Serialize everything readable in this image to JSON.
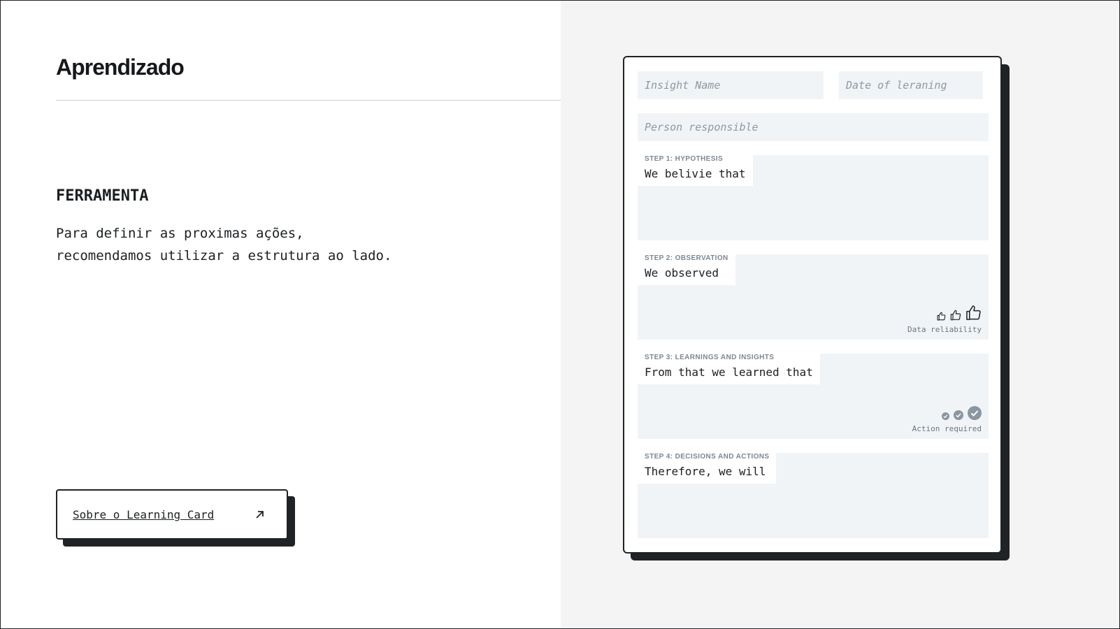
{
  "left": {
    "title": "Aprendizado",
    "section_label": "FERRAMENTA",
    "description_line1": "Para definir as proximas ações,",
    "description_line2": "recomendamos utilizar a estrutura ao lado.",
    "link_button_label": "Sobre o Learning Card",
    "link_button_icon": "arrow-up-right-icon"
  },
  "card": {
    "insight_name_placeholder": "Insight Name",
    "date_placeholder": "Date of leraning",
    "person_placeholder": "Person responsible",
    "steps": [
      {
        "label": "STEP 1: HYPOTHESIS",
        "text": "We belivie that"
      },
      {
        "label": "STEP 2: OBSERVATION",
        "text": "We observed",
        "rating_caption": "Data reliability",
        "rating_icon": "thumbs-up-icon"
      },
      {
        "label": "STEP 3: LEARNINGS AND INSIGHTS",
        "text": "From that we learned that",
        "rating_caption": "Action required",
        "rating_icon": "check-circle-icon"
      },
      {
        "label": "STEP 4: DECISIONS AND ACTIONS",
        "text": "Therefore, we will"
      }
    ]
  },
  "colors": {
    "ink": "#1f2326",
    "field_bg": "#f1f4f7",
    "right_pane_bg": "#f4f4f4",
    "muted_text": "#8d98a3",
    "icon_fill": "#8a96a2"
  }
}
